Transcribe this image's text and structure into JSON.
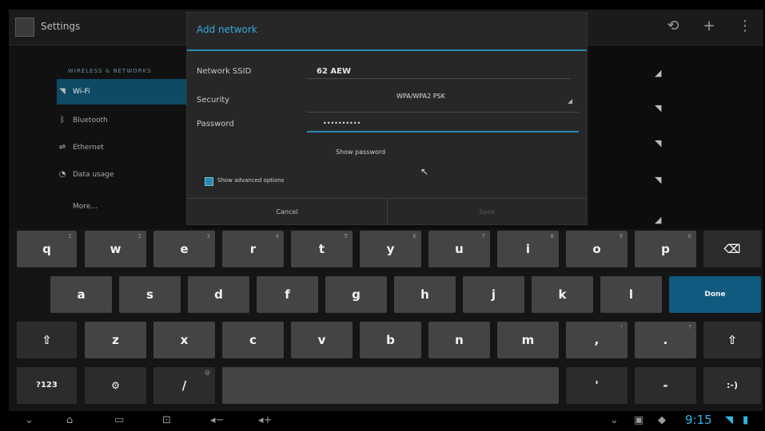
{
  "app": {
    "title": "Settings"
  },
  "action_bar": {
    "icons": [
      "scan-icon",
      "add-icon",
      "overflow-icon"
    ]
  },
  "sidebar": {
    "header": "WIRELESS & NETWORKS",
    "items": [
      {
        "label": "Wi-Fi",
        "icon": "wifi-icon",
        "selected": true
      },
      {
        "label": "Bluetooth",
        "icon": "bluetooth-icon"
      },
      {
        "label": "Ethernet",
        "icon": "ethernet-icon"
      },
      {
        "label": "Data usage",
        "icon": "data-usage-icon"
      },
      {
        "label": "More…",
        "icon": ""
      }
    ]
  },
  "dialog": {
    "title": "Add network",
    "ssid_label": "Network SSID",
    "ssid_value": "62 AEW",
    "security_label": "Security",
    "security_value": "WPA/WPA2 PSK",
    "password_label": "Password",
    "password_value": "••••••••••",
    "show_password_label": "Show password",
    "advanced_options_label": "Show advanced options",
    "cancel_label": "Cancel",
    "save_label": "Save"
  },
  "keyboard": {
    "row1": [
      {
        "k": "q",
        "s": "1"
      },
      {
        "k": "w",
        "s": "2"
      },
      {
        "k": "e",
        "s": "3"
      },
      {
        "k": "r",
        "s": "4"
      },
      {
        "k": "t",
        "s": "5"
      },
      {
        "k": "y",
        "s": "6"
      },
      {
        "k": "u",
        "s": "7"
      },
      {
        "k": "i",
        "s": "8"
      },
      {
        "k": "o",
        "s": "9"
      },
      {
        "k": "p",
        "s": "0"
      }
    ],
    "backspace": "⌫",
    "row2": [
      {
        "k": "a",
        "s": ""
      },
      {
        "k": "s",
        "s": ""
      },
      {
        "k": "d",
        "s": ""
      },
      {
        "k": "f",
        "s": ""
      },
      {
        "k": "g",
        "s": ""
      },
      {
        "k": "h",
        "s": ""
      },
      {
        "k": "j",
        "s": ""
      },
      {
        "k": "k",
        "s": ""
      },
      {
        "k": "l",
        "s": ""
      }
    ],
    "done": "Done",
    "shift": "⇧",
    "row3": [
      {
        "k": "z",
        "s": ""
      },
      {
        "k": "x",
        "s": ""
      },
      {
        "k": "c",
        "s": ""
      },
      {
        "k": "v",
        "s": ""
      },
      {
        "k": "b",
        "s": ""
      },
      {
        "k": "n",
        "s": ""
      },
      {
        "k": "m",
        "s": ""
      },
      {
        "k": ",",
        "s": "!"
      },
      {
        "k": ".",
        "s": "?"
      }
    ],
    "symbols": "?123",
    "settings_key": "⚙",
    "slash": "/",
    "slash_sup": "@",
    "space": "",
    "quote": "'",
    "dash": "-",
    "smiley": ":-)"
  },
  "nav": {
    "icons": [
      "hide-keyboard-icon",
      "home-icon",
      "recent-apps-icon",
      "screenshot-icon",
      "volume-down-icon",
      "volume-up-icon"
    ],
    "clock": "9:15"
  }
}
